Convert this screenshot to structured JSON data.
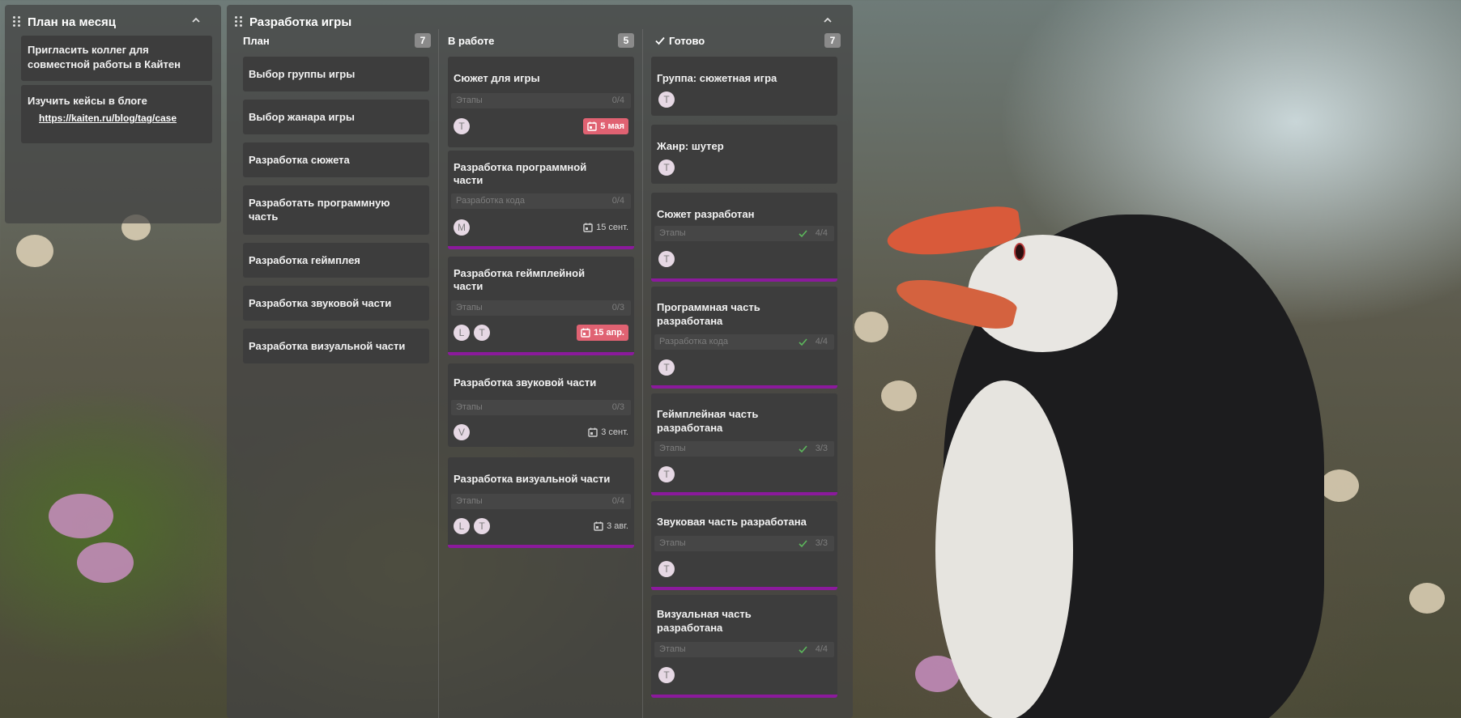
{
  "boards": {
    "month": {
      "title": "План на месяц",
      "notes": [
        {
          "text_lines": [
            "Пригласить коллег для",
            "совместной работы в Кайтен"
          ]
        },
        {
          "text_lines": [
            "Изучить кейсы в блоге"
          ],
          "link": "https://kaiten.ru/blog/tag/case"
        }
      ]
    },
    "dev": {
      "title": "Разработка игры",
      "columns": [
        {
          "title": "План",
          "count": "7",
          "cards": [
            {
              "title_lines": [
                "Выбор группы игры"
              ]
            },
            {
              "title_lines": [
                "Выбор жанара игры"
              ]
            },
            {
              "title_lines": [
                "Разработка сюжета"
              ]
            },
            {
              "title_lines": [
                "Разработать программную",
                "часть"
              ]
            },
            {
              "title_lines": [
                "Разработка геймплея"
              ]
            },
            {
              "title_lines": [
                "Разработка звуковой части"
              ]
            },
            {
              "title_lines": [
                "Разработка визуальной части"
              ]
            }
          ]
        },
        {
          "title": "В работе",
          "count": "5",
          "cards": [
            {
              "title_lines": [
                "Сюжет для игры"
              ],
              "stage": "Этапы",
              "progress": "0/4",
              "avatars": [
                "T"
              ],
              "due": "5 мая",
              "overdue": true
            },
            {
              "title_lines": [
                "Разработка программной",
                "части"
              ],
              "stage": "Разработка кода",
              "progress": "0/4",
              "avatars": [
                "M"
              ],
              "due": "15 сент.",
              "overdue": false
            },
            {
              "title_lines": [
                "Разработка геймплейной",
                "части"
              ],
              "stage": "Этапы",
              "progress": "0/3",
              "avatars": [
                "L",
                "T"
              ],
              "due": "15 апр.",
              "overdue": true
            },
            {
              "title_lines": [
                "Разработка звуковой части"
              ],
              "stage": "Этапы",
              "progress": "0/3",
              "avatars": [
                "V"
              ],
              "due": "3 сент.",
              "overdue": false
            },
            {
              "title_lines": [
                "Разработка визуальной части"
              ],
              "stage": "Этапы",
              "progress": "0/4",
              "avatars": [
                "L",
                "T"
              ],
              "due": "3 авг.",
              "overdue": false
            }
          ]
        },
        {
          "title": "Готово",
          "count": "7",
          "cards": [
            {
              "title_lines": [
                "Группа: сюжетная игра"
              ],
              "avatars": [
                "T"
              ]
            },
            {
              "title_lines": [
                "Жанр: шутер"
              ],
              "avatars": [
                "T"
              ]
            },
            {
              "title_lines": [
                "Сюжет разработан"
              ],
              "stage": "Этапы",
              "progress": "4/4",
              "avatars": [
                "T"
              ]
            },
            {
              "title_lines": [
                "Программная часть",
                "разработана"
              ],
              "stage": "Разработка кода",
              "progress": "4/4",
              "avatars": [
                "T"
              ]
            },
            {
              "title_lines": [
                "Геймплейная часть",
                "разработана"
              ],
              "stage": "Этапы",
              "progress": "3/3",
              "avatars": [
                "T"
              ]
            },
            {
              "title_lines": [
                "Звуковая часть разработана"
              ],
              "stage": "Этапы",
              "progress": "3/3",
              "avatars": [
                "T"
              ]
            },
            {
              "title_lines": [
                "Визуальная часть",
                "разработана"
              ],
              "stage": "Этапы",
              "progress": "4/4",
              "avatars": [
                "T"
              ]
            }
          ]
        }
      ]
    }
  },
  "colors": {
    "accent_bar": "#8b1a9c",
    "overdue": "#e06272",
    "check": "#5cb85c"
  },
  "icons": {
    "drag": "drag-handle-icon",
    "collapse": "chevron-up-icon",
    "done": "check-icon",
    "calendar": "calendar-icon"
  }
}
